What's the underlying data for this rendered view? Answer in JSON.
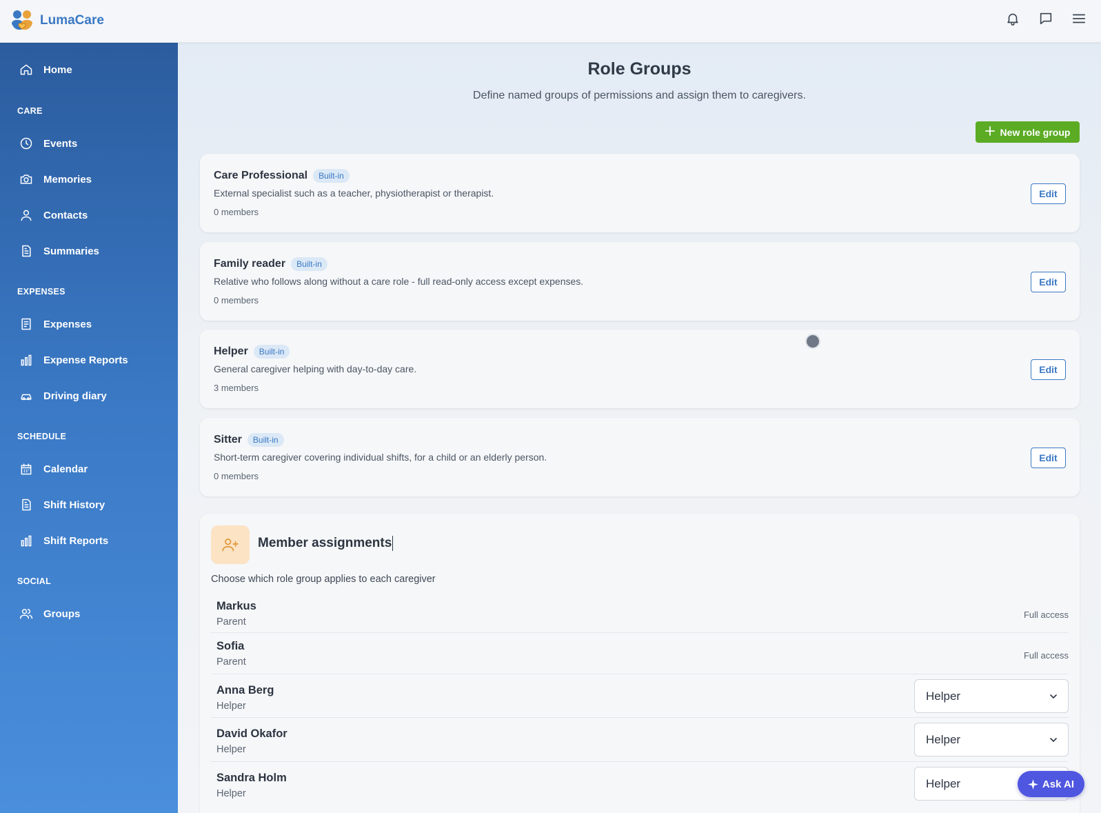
{
  "app": {
    "name": "LumaCare"
  },
  "topbar": {
    "icons": [
      "bell-icon",
      "chat-icon",
      "menu-icon"
    ]
  },
  "sidebar": {
    "home": "Home",
    "sections": [
      {
        "title": "CARE",
        "items": [
          "Events",
          "Memories",
          "Contacts",
          "Summaries"
        ]
      },
      {
        "title": "EXPENSES",
        "items": [
          "Expenses",
          "Expense Reports",
          "Driving diary"
        ]
      },
      {
        "title": "SCHEDULE",
        "items": [
          "Calendar",
          "Shift History",
          "Shift Reports"
        ]
      },
      {
        "title": "SOCIAL",
        "items": [
          "Groups"
        ]
      }
    ]
  },
  "page": {
    "title": "Role Groups",
    "subtitle": "Define named groups of permissions and assign them to caregivers.",
    "new_button": "New role group"
  },
  "role_groups": [
    {
      "name": "Care Professional",
      "badge": "Built-in",
      "description": "External specialist such as a teacher, physiotherapist or therapist.",
      "members": "0 members",
      "edit": "Edit"
    },
    {
      "name": "Family reader",
      "badge": "Built-in",
      "description": "Relative who follows along without a care role - full read-only access except expenses.",
      "members": "0 members",
      "edit": "Edit"
    },
    {
      "name": "Helper",
      "badge": "Built-in",
      "description": "General caregiver helping with day-to-day care.",
      "members": "3 members",
      "edit": "Edit"
    },
    {
      "name": "Sitter",
      "badge": "Built-in",
      "description": "Short-term caregiver covering individual shifts, for a child or an elderly person.",
      "members": "0 members",
      "edit": "Edit"
    }
  ],
  "assignments": {
    "title": "Member assignments",
    "subtitle": "Choose which role group applies to each caregiver",
    "members": [
      {
        "name": "Markus",
        "role": "Parent",
        "access": "Full access"
      },
      {
        "name": "Sofia",
        "role": "Parent",
        "access": "Full access"
      },
      {
        "name": "Anna Berg",
        "role": "Helper",
        "select": "Helper"
      },
      {
        "name": "David Okafor",
        "role": "Helper",
        "select": "Helper"
      },
      {
        "name": "Sandra Holm",
        "role": "Helper",
        "select": "Helper"
      }
    ]
  },
  "ask_ai": "Ask AI",
  "colors": {
    "primary": "#3a78c4",
    "success": "#5bab24",
    "ai": "#4f56e0",
    "accent_bg": "#fbe3c4"
  }
}
